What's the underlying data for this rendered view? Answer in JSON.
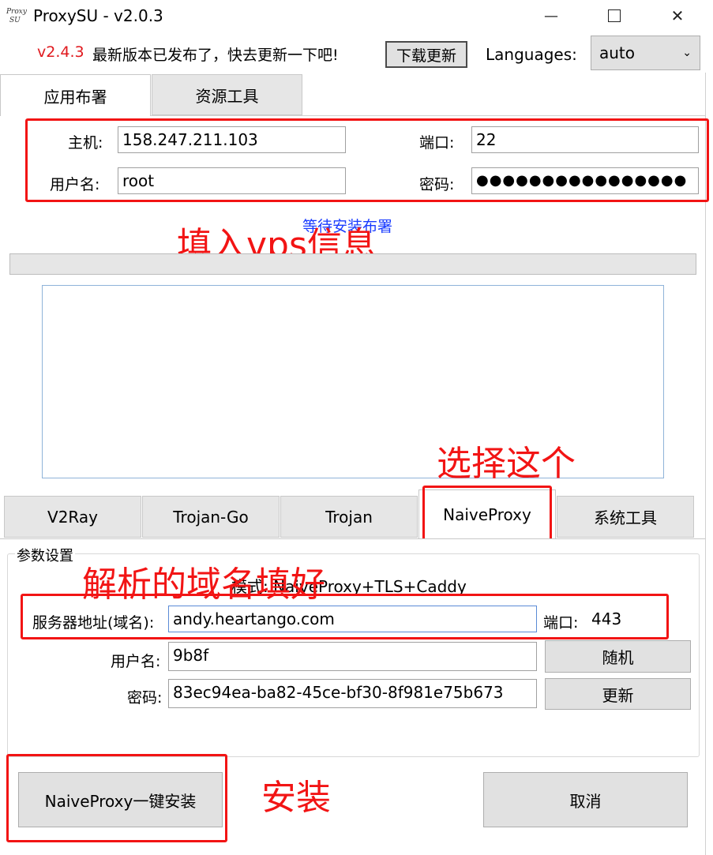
{
  "window": {
    "title": "ProxySU - v2.0.3",
    "logo_text": "ProxySU",
    "controls": {
      "minimize": "—",
      "maximize": "☐",
      "close": "✕"
    }
  },
  "update_bar": {
    "version": "v2.4.3",
    "message": "最新版本已发布了，快去更新一下吧!",
    "download_button": "下载更新",
    "languages_label": "Languages:",
    "language_value": "auto"
  },
  "top_tabs": [
    {
      "label": "应用布署",
      "active": true
    },
    {
      "label": "资源工具",
      "active": false
    }
  ],
  "server": {
    "host_label": "主机:",
    "host_value": "158.247.211.103",
    "port_label": "端口:",
    "port_value": "22",
    "user_label": "用户名:",
    "user_value": "root",
    "password_label": "密码:",
    "password_value": "●●●●●●●●●●●●●●●●"
  },
  "status_text": "等待安装布署",
  "protocol_tabs": [
    {
      "label": "V2Ray",
      "active": false
    },
    {
      "label": "Trojan-Go",
      "active": false
    },
    {
      "label": "Trojan",
      "active": false
    },
    {
      "label": "NaiveProxy",
      "active": true
    },
    {
      "label": "系统工具",
      "active": false
    }
  ],
  "params": {
    "group_title": "参数设置",
    "mode_text": "模式: NaiveProxy+TLS+Caddy",
    "domain_label": "服务器地址(域名):",
    "domain_value": "andy.heartango.com",
    "port_label": "端口:",
    "port_value": "443",
    "user_label": "用户名:",
    "user_value": "9b8f",
    "random_button": "随机",
    "password_label": "密码:",
    "password_value": "83ec94ea-ba82-45ce-bf30-8f981e75b673",
    "refresh_button": "更新"
  },
  "actions": {
    "install_button": "NaiveProxy一键安装",
    "cancel_button": "取消"
  },
  "annotations": {
    "fill_vps": "填入vps信息",
    "choose_this": "选择这个",
    "fill_domain": "解析的域名填好",
    "install": "安装"
  },
  "colors": {
    "annotation_red": "#f21414",
    "version_red": "#e0191e",
    "status_blue": "#1a3cff"
  }
}
